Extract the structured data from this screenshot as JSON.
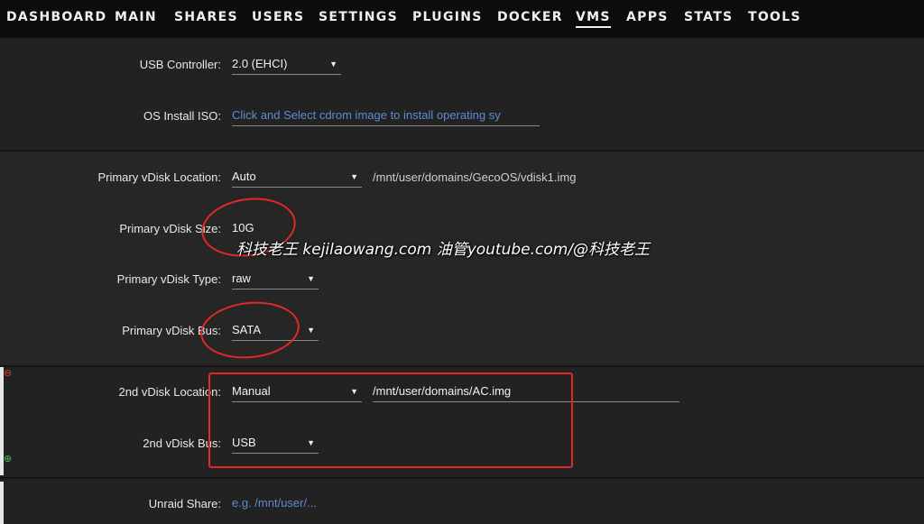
{
  "nav": {
    "items": [
      "DASHBOARD",
      "MAIN",
      "SHARES",
      "USERS",
      "SETTINGS",
      "PLUGINS",
      "DOCKER",
      "VMS",
      "APPS",
      "STATS",
      "TOOLS"
    ],
    "active": "VMS"
  },
  "usb_controller": {
    "label": "USB Controller:",
    "value": "2.0 (EHCI)"
  },
  "os_install_iso": {
    "label": "OS Install ISO:",
    "placeholder": "Click and Select cdrom image to install operating sy"
  },
  "primary_vdisk": {
    "location_label": "Primary vDisk Location:",
    "location_value": "Auto",
    "location_path": "/mnt/user/domains/GecoOS/vdisk1.img",
    "size_label": "Primary vDisk Size:",
    "size_value": "10G",
    "type_label": "Primary vDisk Type:",
    "type_value": "raw",
    "bus_label": "Primary vDisk Bus:",
    "bus_value": "SATA"
  },
  "second_vdisk": {
    "location_label": "2nd vDisk Location:",
    "location_value": "Manual",
    "location_path": "/mnt/user/domains/AC.img",
    "bus_label": "2nd vDisk Bus:",
    "bus_value": "USB"
  },
  "unraid_share": {
    "label": "Unraid Share:",
    "placeholder": "e.g. /mnt/user/..."
  },
  "watermark": "科技老王 kejilaowang.com 油管youtube.com/@科技老王",
  "colors": {
    "highlight": "#e22828",
    "placeholder": "#5d8ad0",
    "background": "#222222"
  }
}
